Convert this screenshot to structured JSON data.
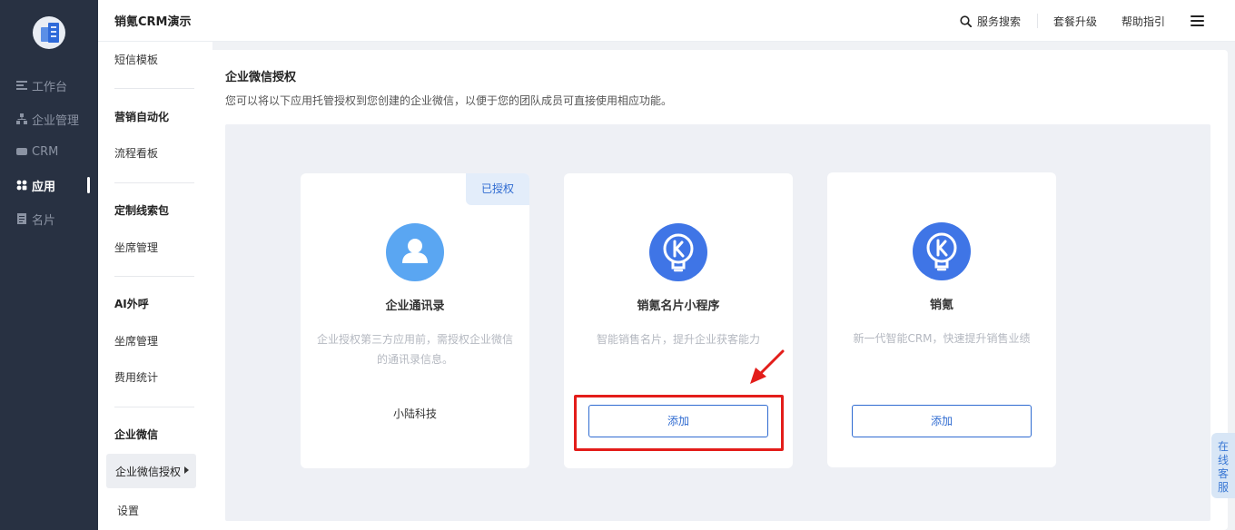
{
  "sidebar": {
    "items": [
      {
        "label": "工作台",
        "icon": "list-icon"
      },
      {
        "label": "企业管理",
        "icon": "org-chart-icon"
      },
      {
        "label": "CRM",
        "icon": "crm-icon"
      },
      {
        "label": "应用",
        "icon": "apps-icon",
        "active": true
      },
      {
        "label": "名片",
        "icon": "card-icon"
      }
    ]
  },
  "header": {
    "title": "销氪CRM演示",
    "search_label": "服务搜索",
    "upgrade_label": "套餐升级",
    "help_label": "帮助指引"
  },
  "submenu": {
    "top_item": "短信模板",
    "group_marketing": "营销自动化",
    "item_flow_board": "流程看板",
    "group_custom_leads": "定制线索包",
    "item_seat_mgmt_1": "坐席管理",
    "group_ai_call": "AI外呼",
    "item_seat_mgmt_2": "坐席管理",
    "item_cost_stats": "费用统计",
    "group_wecom": "企业微信",
    "item_wecom_auth": "企业微信授权",
    "item_settings": "设置"
  },
  "content": {
    "title": "企业微信授权",
    "description": "您可以将以下应用托管授权到您创建的企业微信，以便于您的团队成员可直接使用相应功能。",
    "cards": [
      {
        "name": "企业通讯录",
        "badge": "已授权",
        "description": "企业授权第三方应用前，需授权企业微信的通讯录信息。",
        "company": "小陆科技",
        "icon": "user-icon",
        "icon_color": "#5aa6f2"
      },
      {
        "name": "销氪名片小程序",
        "description": "智能销售名片，提升企业获客能力",
        "button_label": "添加",
        "icon": "bulb-k-icon",
        "icon_color": "#3f75e6"
      },
      {
        "name": "销氪",
        "description": "新一代智能CRM，快速提升销售业绩",
        "button_label": "添加",
        "icon": "bulb-k-icon",
        "icon_color": "#3f75e6"
      }
    ]
  },
  "floating": {
    "online_service": "在线客服"
  },
  "colors": {
    "sidebar_bg": "#283142",
    "accent": "#2f6bd1",
    "highlight": "#e31d1a"
  }
}
